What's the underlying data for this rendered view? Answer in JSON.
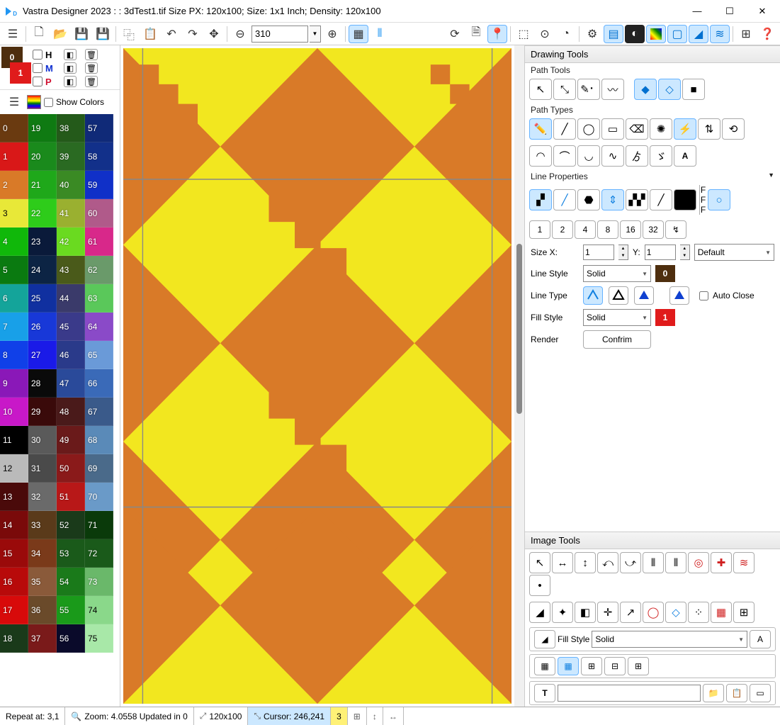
{
  "title": "Vastra Designer 2023 : : 3dTest1.tif Size PX: 120x100; Size: 1x1 Inch; Density: 120x100",
  "toolbar": {
    "zoom_value": "310"
  },
  "swatches": {
    "primary": {
      "color": "#4e2e0e",
      "label": "0"
    },
    "secondary": {
      "color": "#e01b1b",
      "label": "1"
    },
    "hmp": [
      {
        "label": "H",
        "color": "#000"
      },
      {
        "label": "M",
        "color": "#1030d0"
      },
      {
        "label": "P",
        "color": "#d01030"
      }
    ],
    "show_colors_label": "Show Colors"
  },
  "palette": [
    [
      {
        "n": "0",
        "c": "#6a3a10"
      },
      {
        "n": "19",
        "c": "#0f7a12"
      },
      {
        "n": "38",
        "c": "#245a1a"
      },
      {
        "n": "57",
        "c": "#102a78"
      }
    ],
    [
      {
        "n": "1",
        "c": "#d91818"
      },
      {
        "n": "20",
        "c": "#1a8a1c"
      },
      {
        "n": "39",
        "c": "#2a6a22"
      },
      {
        "n": "58",
        "c": "#12308a"
      }
    ],
    [
      {
        "n": "2",
        "c": "#d97a28"
      },
      {
        "n": "21",
        "c": "#1fa81a"
      },
      {
        "n": "40",
        "c": "#3a8a24"
      },
      {
        "n": "59",
        "c": "#1030c8"
      }
    ],
    [
      {
        "n": "3",
        "c": "#e8e838"
      },
      {
        "n": "22",
        "c": "#2ecc1a"
      },
      {
        "n": "41",
        "c": "#9ab030"
      },
      {
        "n": "60",
        "c": "#b05a8a"
      }
    ],
    [
      {
        "n": "4",
        "c": "#10b80a"
      },
      {
        "n": "23",
        "c": "#0a1a3a"
      },
      {
        "n": "42",
        "c": "#6ada20"
      },
      {
        "n": "61",
        "c": "#d8288a"
      }
    ],
    [
      {
        "n": "5",
        "c": "#0a7a10"
      },
      {
        "n": "24",
        "c": "#0c2444"
      },
      {
        "n": "43",
        "c": "#4a5a1a"
      },
      {
        "n": "62",
        "c": "#6a9a6a"
      }
    ],
    [
      {
        "n": "6",
        "c": "#14a49a"
      },
      {
        "n": "25",
        "c": "#1030a0"
      },
      {
        "n": "44",
        "c": "#3a3a6a"
      },
      {
        "n": "63",
        "c": "#5ac85a"
      }
    ],
    [
      {
        "n": "7",
        "c": "#18a0e8"
      },
      {
        "n": "26",
        "c": "#1838d8"
      },
      {
        "n": "45",
        "c": "#3a3a8a"
      },
      {
        "n": "64",
        "c": "#8a4ac8"
      }
    ],
    [
      {
        "n": "8",
        "c": "#1040e8"
      },
      {
        "n": "27",
        "c": "#1a1ae8"
      },
      {
        "n": "46",
        "c": "#2a3a8a"
      },
      {
        "n": "65",
        "c": "#6a9ad8"
      }
    ],
    [
      {
        "n": "9",
        "c": "#8a18b8"
      },
      {
        "n": "28",
        "c": "#0a0a0a"
      },
      {
        "n": "47",
        "c": "#2a4a9a"
      },
      {
        "n": "66",
        "c": "#3a6ab8"
      }
    ],
    [
      {
        "n": "10",
        "c": "#c818c8"
      },
      {
        "n": "29",
        "c": "#3a0a0a"
      },
      {
        "n": "48",
        "c": "#4a1a1a"
      },
      {
        "n": "67",
        "c": "#3a5a8a"
      }
    ],
    [
      {
        "n": "11",
        "c": "#000000"
      },
      {
        "n": "30",
        "c": "#5a5a5a"
      },
      {
        "n": "49",
        "c": "#6a1a1a"
      },
      {
        "n": "68",
        "c": "#5a8ab8"
      }
    ],
    [
      {
        "n": "12",
        "c": "#bababa"
      },
      {
        "n": "31",
        "c": "#4a4a4a"
      },
      {
        "n": "50",
        "c": "#8a1a1a"
      },
      {
        "n": "69",
        "c": "#4a6a8a"
      }
    ],
    [
      {
        "n": "13",
        "c": "#4a0a0a"
      },
      {
        "n": "32",
        "c": "#6a6a6a"
      },
      {
        "n": "51",
        "c": "#b81818"
      },
      {
        "n": "70",
        "c": "#6a9ac8"
      }
    ],
    [
      {
        "n": "14",
        "c": "#7a0a0a"
      },
      {
        "n": "33",
        "c": "#5a3a1a"
      },
      {
        "n": "52",
        "c": "#1a3a1a"
      },
      {
        "n": "71",
        "c": "#0a3a0a"
      }
    ],
    [
      {
        "n": "15",
        "c": "#9a0a0a"
      },
      {
        "n": "34",
        "c": "#7a3a1a"
      },
      {
        "n": "53",
        "c": "#1a5a1a"
      },
      {
        "n": "72",
        "c": "#1a5a1a"
      }
    ],
    [
      {
        "n": "16",
        "c": "#b80a0a"
      },
      {
        "n": "35",
        "c": "#8a5a3a"
      },
      {
        "n": "54",
        "c": "#1a7a1a"
      },
      {
        "n": "73",
        "c": "#6ab86a"
      }
    ],
    [
      {
        "n": "17",
        "c": "#d80a0a"
      },
      {
        "n": "36",
        "c": "#6a4a2a"
      },
      {
        "n": "55",
        "c": "#1a9a1a"
      },
      {
        "n": "74",
        "c": "#8ad88a"
      }
    ],
    [
      {
        "n": "18",
        "c": "#1a3a1a"
      },
      {
        "n": "37",
        "c": "#7a1a1a"
      },
      {
        "n": "56",
        "c": "#0a0a2a"
      },
      {
        "n": "75",
        "c": "#a8e8a8"
      }
    ]
  ],
  "right": {
    "header": "Drawing Tools",
    "path_tools_label": "Path Tools",
    "path_types_label": "Path Types",
    "line_props_label": "Line Properties",
    "thickness": [
      "1",
      "2",
      "4",
      "8",
      "16",
      "32"
    ],
    "size_x_label": "Size X:",
    "size_x": "1",
    "y_label": "Y:",
    "size_y": "1",
    "size_mode": "Default",
    "line_style_label": "Line Style",
    "line_style": "Solid",
    "line_style_color": {
      "c": "#4e2e0e",
      "label": "0"
    },
    "line_type_label": "Line Type",
    "auto_close_label": "Auto Close",
    "fill_style_label": "Fill Style",
    "fill_style": "Solid",
    "fill_style_color": {
      "c": "#e01b1b",
      "label": "1"
    },
    "render_label": "Render",
    "confirm_label": "Confrim",
    "image_tools_label": "Image Tools",
    "img_fill_label": "Fill Style",
    "img_fill": "Solid",
    "img_fill_a": "A"
  },
  "status": {
    "repeat": "Repeat at: 3,1",
    "zoom": "Zoom: 4.0558 Updated in 0",
    "dims": "120x100",
    "cursor": "Cursor: 246,241",
    "sel": "3"
  }
}
